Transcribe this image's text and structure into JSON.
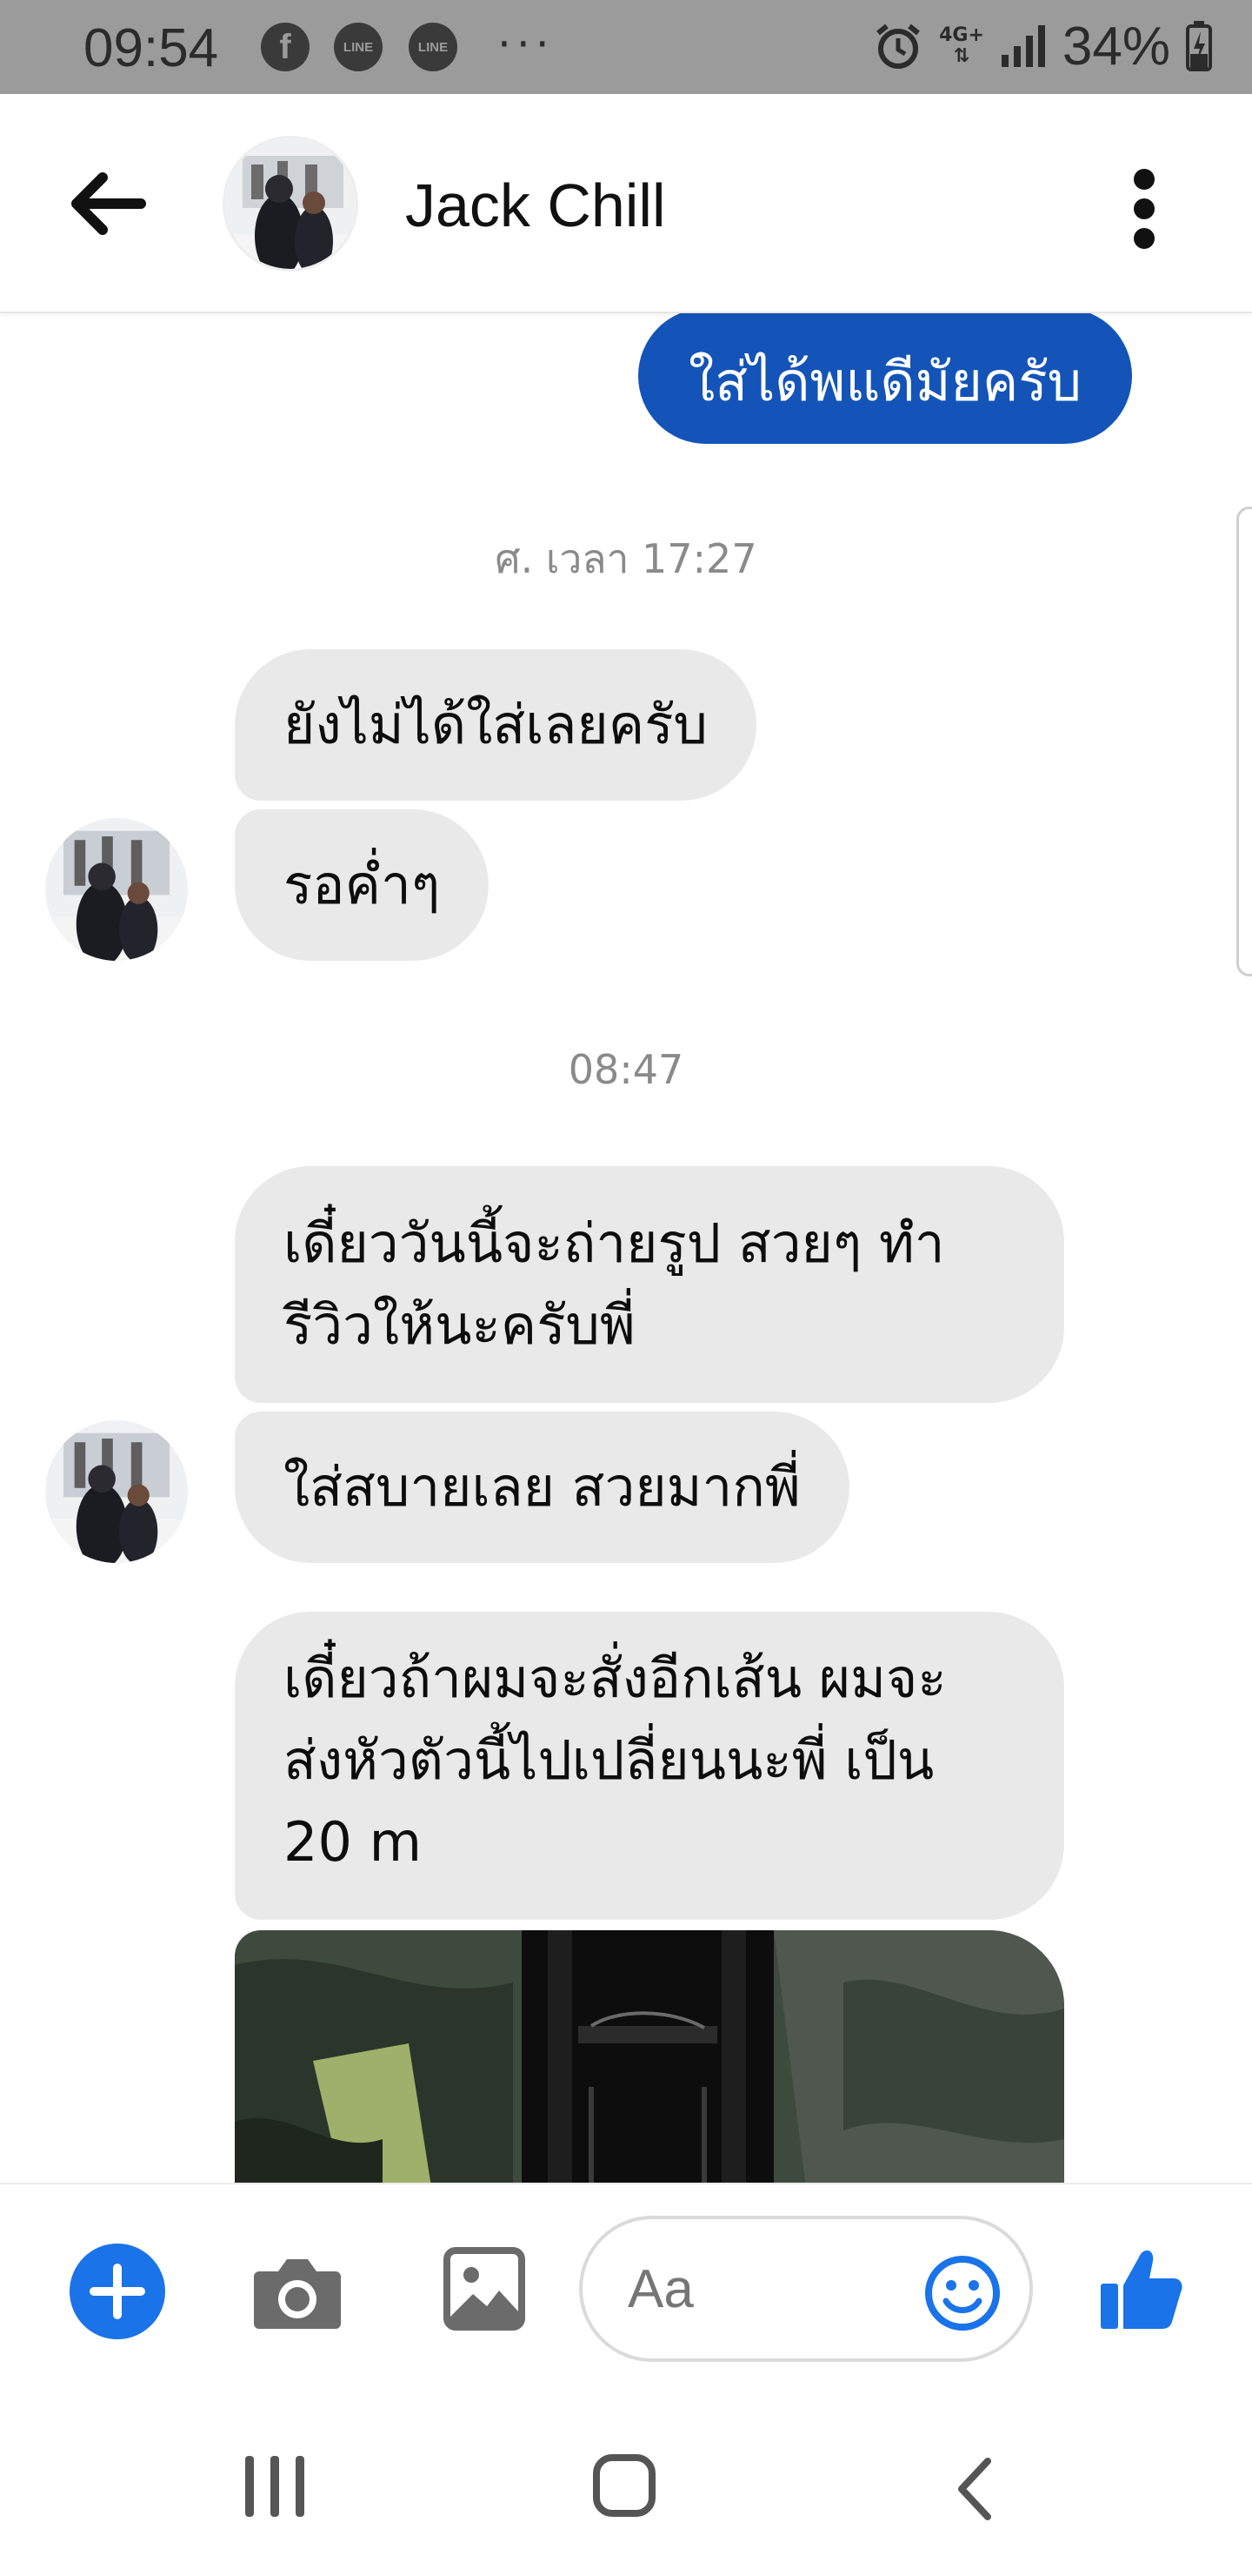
{
  "status_bar": {
    "time": "09:54",
    "notification_icons": [
      "f",
      "LINE",
      "LINE"
    ],
    "more": "···",
    "network": "4G+",
    "battery": "34%"
  },
  "header": {
    "contact_name": "Jack Chill",
    "back_icon": "arrow-left-icon",
    "menu_icon": "more-vertical-icon"
  },
  "thread": {
    "outgoing": [
      {
        "text": "ใส่ได้พแดีมัยครับ"
      }
    ],
    "timestamps": [
      "ศ. เวลา 17:27",
      "08:47"
    ],
    "incoming": [
      {
        "text": "ยังไม่ได้ใส่เลยครับ"
      },
      {
        "text": "รอค่ำๆ"
      },
      {
        "lines": [
          "เดี๋ยววันนี้จะถ่ายรูป สวยๆ ทำ",
          "รีวิวให้นะครับพี่"
        ]
      },
      {
        "text": "ใส่สบายเลย สวยมากพี่"
      },
      {
        "lines": [
          "เดี๋ยวถ้าผมจะสั่งอีกเส้น ผมจะ",
          "ส่งหัวตัวนี้ไปเปลี่ยนนะพี่ เป็น",
          "20 m"
        ]
      }
    ]
  },
  "composer": {
    "placeholder": "Aa",
    "icons": [
      "plus-icon",
      "camera-icon",
      "gallery-icon",
      "emoji-icon",
      "thumbs-up-icon"
    ],
    "accent_color": "#1a73e8"
  },
  "colors": {
    "outgoing_bubble": "#1454b8",
    "incoming_bubble": "#e9e9e9",
    "status_bar": "#9b9b9b"
  }
}
